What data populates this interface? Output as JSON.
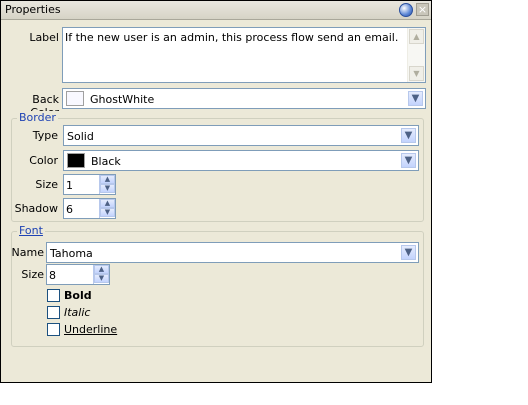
{
  "window": {
    "title": "Properties"
  },
  "label": {
    "caption": "Label",
    "value": "If the new user is an admin, this process flow send an email."
  },
  "back_color": {
    "caption": "Back Color",
    "value": "GhostWhite",
    "swatch": "#f8f8ff"
  },
  "border": {
    "legend": "Border",
    "type": {
      "caption": "Type",
      "value": "Solid"
    },
    "color": {
      "caption": "Color",
      "value": "Black",
      "swatch": "#000000"
    },
    "size": {
      "caption": "Size",
      "value": "1"
    },
    "shadow": {
      "caption": "Shadow",
      "value": "6"
    }
  },
  "font": {
    "legend": "Font",
    "name": {
      "caption": "Name",
      "value": "Tahoma"
    },
    "size": {
      "caption": "Size",
      "value": "8"
    },
    "bold": {
      "label": "Bold",
      "checked": false
    },
    "italic": {
      "label": "Italic",
      "checked": false
    },
    "underline": {
      "label": "Underline",
      "checked": false
    }
  },
  "icons": {
    "pin": "pin-icon",
    "close": "close-icon",
    "dropdown": "chevron-down-icon",
    "spin_up": "spin-up-icon",
    "spin_down": "spin-down-icon"
  }
}
